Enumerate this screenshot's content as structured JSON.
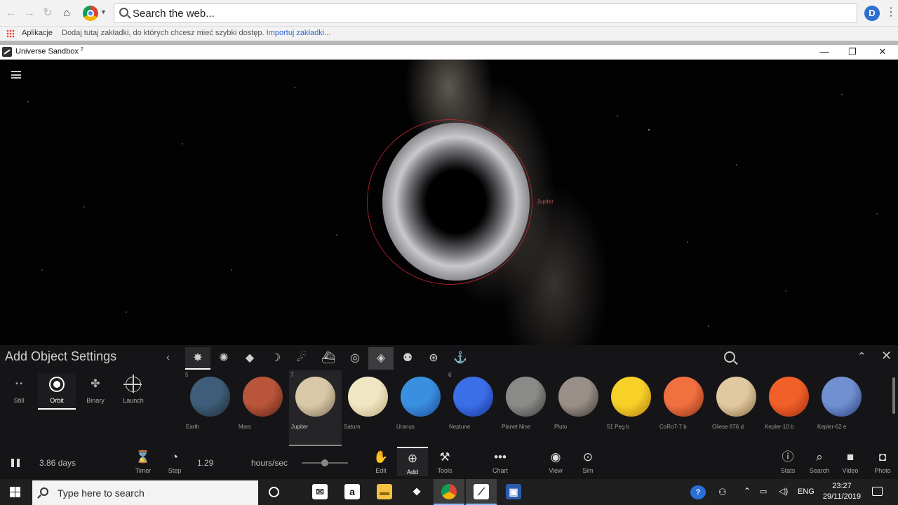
{
  "browser": {
    "address_placeholder": "Search the web...",
    "profile_initial": "D",
    "bookmarks": {
      "apps_label": "Aplikacje",
      "hint": "Dodaj tutaj zakładki, do których chcesz mieć szybki dostęp.",
      "import_link": "Importuj zakładki..."
    }
  },
  "app": {
    "title": "Universe Sandbox",
    "title_sup": "2",
    "window_buttons": {
      "minimize": "—",
      "restore": "❐",
      "close": "✕"
    }
  },
  "scene": {
    "orbit_label": "Jupiter"
  },
  "panel": {
    "title": "Add Object Settings",
    "modes": [
      {
        "label": "Still",
        "selected": false
      },
      {
        "label": "Orbit",
        "selected": true
      },
      {
        "label": "Binary",
        "selected": false
      },
      {
        "label": "Launch",
        "selected": false
      }
    ],
    "categories": [
      {
        "icon": "space-objects-icon",
        "glyph": "✸"
      },
      {
        "icon": "star-icon",
        "glyph": "✺"
      },
      {
        "icon": "galaxy-icon",
        "glyph": "◆"
      },
      {
        "icon": "moon-icon",
        "glyph": "☽"
      },
      {
        "icon": "comet-icon",
        "glyph": "☄"
      },
      {
        "icon": "spacecraft-icon",
        "glyph": "⛴"
      },
      {
        "icon": "spiral-icon",
        "glyph": "◎"
      },
      {
        "icon": "planet-icon",
        "glyph": "◈"
      },
      {
        "icon": "person-icon",
        "glyph": "⚉"
      },
      {
        "icon": "ring-icon",
        "glyph": "⊛"
      },
      {
        "icon": "anchor-icon",
        "glyph": "⚓"
      }
    ],
    "objects": [
      {
        "name": "Earth",
        "num": "5",
        "color": "#3f5d78",
        "color2": "#1c2a38",
        "selected": false
      },
      {
        "name": "Mars",
        "num": "",
        "color": "#b8553a",
        "color2": "#5a2215",
        "selected": false
      },
      {
        "name": "Jupiter",
        "num": "7",
        "color": "#d9c8a8",
        "color2": "#7a6a52",
        "selected": true
      },
      {
        "name": "Saturn",
        "num": "",
        "color": "#f1e6c4",
        "color2": "#b8a878",
        "selected": false
      },
      {
        "name": "Uranus",
        "num": "",
        "color": "#3a8fe0",
        "color2": "#1a4a95",
        "selected": false
      },
      {
        "name": "Neptune",
        "num": "6",
        "color": "#3a6fe8",
        "color2": "#1a3090",
        "selected": false
      },
      {
        "name": "Planet Nine",
        "num": "",
        "color": "#8a8a88",
        "color2": "#3a3a38",
        "selected": false
      },
      {
        "name": "Pluto",
        "num": "",
        "color": "#9a8f88",
        "color2": "#3d3530",
        "selected": false
      },
      {
        "name": "51 Peg b",
        "num": "",
        "color": "#f7d028",
        "color2": "#b07a10",
        "selected": false
      },
      {
        "name": "CoRoT-7 b",
        "num": "",
        "color": "#f07040",
        "color2": "#8a3015",
        "selected": false
      },
      {
        "name": "Gliese 876 d",
        "num": "",
        "color": "#e0c8a0",
        "color2": "#8a6a40",
        "selected": false
      },
      {
        "name": "Kepler-10 b",
        "num": "",
        "color": "#f06028",
        "color2": "#a02a10",
        "selected": false
      },
      {
        "name": "Kepler-62 e",
        "num": "",
        "color": "#7090d0",
        "color2": "#2a3a78",
        "selected": false
      }
    ]
  },
  "controls": {
    "time_value": "3.86 days",
    "speed_value": "1.29",
    "speed_unit": "hours/sec",
    "buttons": [
      {
        "label": "Timer",
        "glyph": "⌛"
      },
      {
        "label": "Step",
        "glyph": "◔"
      },
      {
        "label": "Edit",
        "glyph": "✋"
      },
      {
        "label": "Add",
        "glyph": "⊕"
      },
      {
        "label": "Tools",
        "glyph": "⚒"
      },
      {
        "label": "Chart",
        "glyph": "•••"
      },
      {
        "label": "View",
        "glyph": "◉"
      },
      {
        "label": "Sim",
        "glyph": "⊙"
      },
      {
        "label": "Stats",
        "glyph": "ⓘ"
      },
      {
        "label": "Search",
        "glyph": "⌕"
      },
      {
        "label": "Video",
        "glyph": "■"
      },
      {
        "label": "Photo",
        "glyph": "◘"
      }
    ]
  },
  "taskbar": {
    "search_placeholder": "Type here to search",
    "language": "ENG",
    "time": "23:27",
    "date": "29/11/2019"
  }
}
